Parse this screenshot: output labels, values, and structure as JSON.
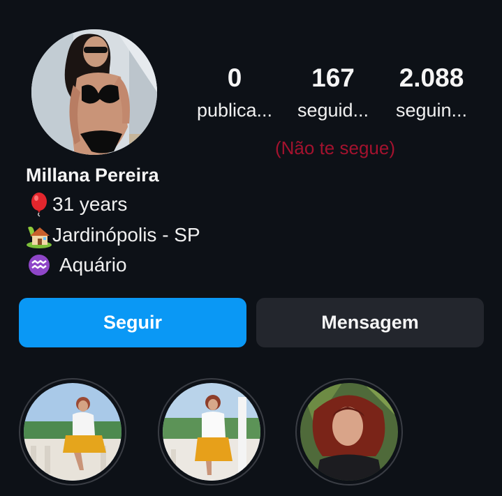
{
  "profile": {
    "display_name": "Millana Pereira",
    "avatar_icon": "profile-photo",
    "follow_status": "(Não te segue)"
  },
  "stats": [
    {
      "count": "0",
      "label": "publica..."
    },
    {
      "count": "167",
      "label": "seguid..."
    },
    {
      "count": "2.088",
      "label": "seguin..."
    }
  ],
  "bio": {
    "age": {
      "icon": "balloon-icon",
      "text": "31 years"
    },
    "location": {
      "icon": "house-with-garden-icon",
      "text": "Jardinópolis - SP"
    },
    "sign": {
      "icon": "aquarius-icon",
      "text": "Aquário"
    }
  },
  "actions": {
    "follow_label": "Seguir",
    "message_label": "Mensagem"
  },
  "highlights": [
    {
      "icon": "story-highlight-cover"
    },
    {
      "icon": "story-highlight-cover"
    },
    {
      "icon": "story-highlight-cover"
    }
  ],
  "colors": {
    "background": "#0d1117",
    "follow_button": "#0a98f5",
    "message_button": "#23262d",
    "not_following_text": "#a3122e"
  }
}
